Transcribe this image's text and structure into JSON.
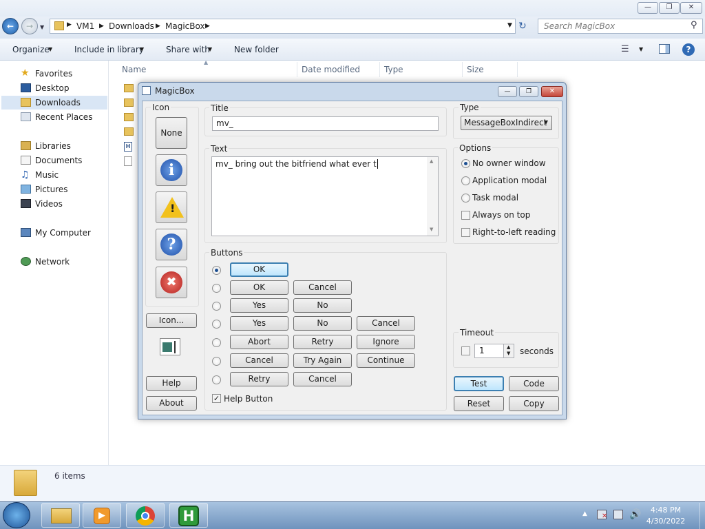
{
  "explorer": {
    "breadcrumb": [
      "VM1",
      "Downloads",
      "MagicBox"
    ],
    "search_placeholder": "Search MagicBox",
    "toolbar": {
      "organize": "Organize",
      "include": "Include in library",
      "share": "Share with",
      "new_folder": "New folder"
    },
    "nav": {
      "favorites": "Favorites",
      "desktop": "Desktop",
      "downloads": "Downloads",
      "recent": "Recent Places",
      "libraries": "Libraries",
      "documents": "Documents",
      "music": "Music",
      "pictures": "Pictures",
      "videos": "Videos",
      "computer": "My Computer",
      "network": "Network"
    },
    "columns": {
      "name": "Name",
      "date": "Date modified",
      "type": "Type",
      "size": "Size"
    },
    "status": "6 items"
  },
  "dialog": {
    "title": "MagicBox",
    "icon_label": "Icon",
    "icon_none": "None",
    "icon_more": "Icon...",
    "help": "Help",
    "about": "About",
    "title_label": "Title",
    "title_value": "mv_",
    "text_label": "Text",
    "text_value": "mv_ bring out the bitfriend what ever t",
    "type_label": "Type",
    "type_value": "MessageBoxIndirect",
    "options_label": "Options",
    "options": {
      "no_owner": "No owner window",
      "app_modal": "Application modal",
      "task_modal": "Task modal",
      "always_top": "Always on top",
      "rtl": "Right-to-left reading"
    },
    "buttons_label": "Buttons",
    "button_rows": [
      [
        "OK"
      ],
      [
        "OK",
        "Cancel"
      ],
      [
        "Yes",
        "No"
      ],
      [
        "Yes",
        "No",
        "Cancel"
      ],
      [
        "Abort",
        "Retry",
        "Ignore"
      ],
      [
        "Cancel",
        "Try Again",
        "Continue"
      ],
      [
        "Retry",
        "Cancel"
      ]
    ],
    "help_button": "Help Button",
    "timeout_label": "Timeout",
    "timeout_value": "1",
    "seconds": "seconds",
    "test": "Test",
    "code": "Code",
    "reset": "Reset",
    "copy": "Copy"
  },
  "taskbar": {
    "time": "4:48 PM",
    "date": "4/30/2022"
  },
  "colors": {
    "accent": "#3c7fb1",
    "info": "#2a5bb8",
    "error": "#c8262c",
    "warning": "#f2c11c"
  }
}
